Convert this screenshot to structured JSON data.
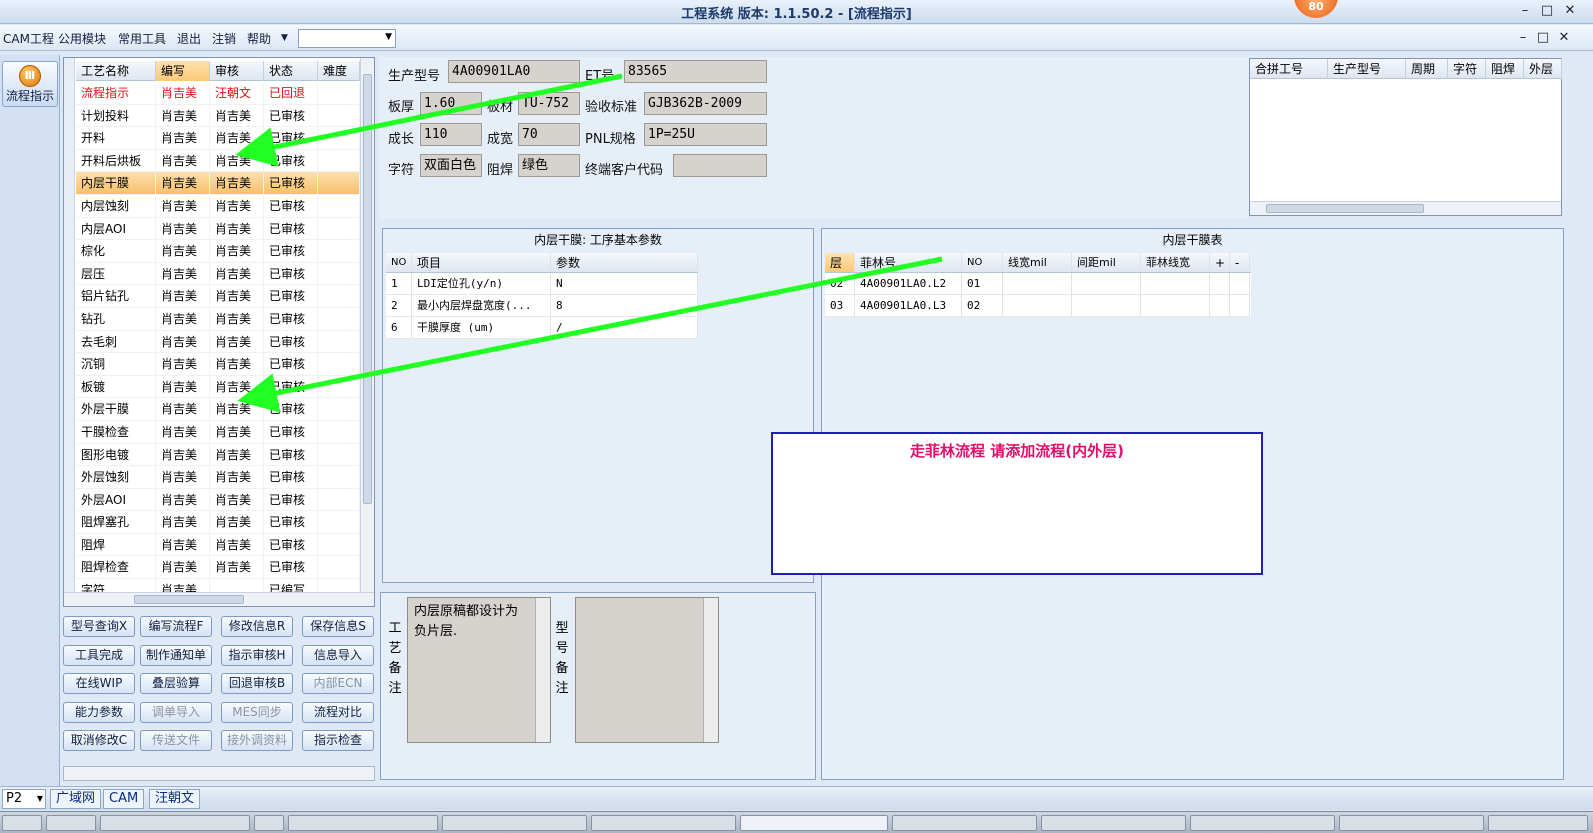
{
  "window": {
    "title": "工程系统  版本: 1.1.50.2 - [流程指示]",
    "badge": "80",
    "controls": [
      "–",
      "□",
      "✕"
    ],
    "inner_controls": [
      "–",
      "□",
      "✕"
    ]
  },
  "menu": {
    "items": [
      "CAM工程",
      "公用模块",
      "常用工具",
      "退出",
      "注销",
      "帮助"
    ],
    "combo_value": ""
  },
  "rail": {
    "button_label": "流程指示"
  },
  "process_list": {
    "columns": [
      "工艺名称",
      "编写",
      "审核",
      "状态",
      "难度"
    ],
    "rows": [
      [
        "流程指示",
        "肖吉美",
        "汪朝文",
        "已回退",
        ""
      ],
      [
        "计划投料",
        "肖吉美",
        "肖吉美",
        "已审核",
        ""
      ],
      [
        "开料",
        "肖吉美",
        "肖吉美",
        "已审核",
        ""
      ],
      [
        "开料后烘板",
        "肖吉美",
        "肖吉美",
        "已审核",
        ""
      ],
      [
        "内层干膜",
        "肖吉美",
        "肖吉美",
        "已审核",
        ""
      ],
      [
        "内层蚀刻",
        "肖吉美",
        "肖吉美",
        "已审核",
        ""
      ],
      [
        "内层AOI",
        "肖吉美",
        "肖吉美",
        "已审核",
        ""
      ],
      [
        "棕化",
        "肖吉美",
        "肖吉美",
        "已审核",
        ""
      ],
      [
        "层压",
        "肖吉美",
        "肖吉美",
        "已审核",
        ""
      ],
      [
        "铝片钻孔",
        "肖吉美",
        "肖吉美",
        "已审核",
        ""
      ],
      [
        "钻孔",
        "肖吉美",
        "肖吉美",
        "已审核",
        ""
      ],
      [
        "去毛刺",
        "肖吉美",
        "肖吉美",
        "已审核",
        ""
      ],
      [
        "沉铜",
        "肖吉美",
        "肖吉美",
        "已审核",
        ""
      ],
      [
        "板镀",
        "肖吉美",
        "肖吉美",
        "已审核",
        ""
      ],
      [
        "外层干膜",
        "肖吉美",
        "肖吉美",
        "已审核",
        ""
      ],
      [
        "干膜检查",
        "肖吉美",
        "肖吉美",
        "已审核",
        ""
      ],
      [
        "图形电镀",
        "肖吉美",
        "肖吉美",
        "已审核",
        ""
      ],
      [
        "外层蚀刻",
        "肖吉美",
        "肖吉美",
        "已审核",
        ""
      ],
      [
        "外层AOI",
        "肖吉美",
        "肖吉美",
        "已审核",
        ""
      ],
      [
        "阻焊塞孔",
        "肖吉美",
        "肖吉美",
        "已审核",
        ""
      ],
      [
        "阻焊",
        "肖吉美",
        "肖吉美",
        "已审核",
        ""
      ],
      [
        "阻焊检查",
        "肖吉美",
        "肖吉美",
        "已审核",
        ""
      ],
      [
        "字符",
        "肖吉美",
        "",
        "已编写",
        ""
      ]
    ],
    "selected_index": 4,
    "red_index": 0
  },
  "actions": [
    {
      "label": "型号查询X",
      "enabled": true
    },
    {
      "label": "编写流程F",
      "enabled": true
    },
    {
      "label": "修改信息R",
      "enabled": true
    },
    {
      "label": "保存信息S",
      "enabled": true
    },
    {
      "label": "工具完成",
      "enabled": true
    },
    {
      "label": "制作通知单",
      "enabled": true
    },
    {
      "label": "指示审核H",
      "enabled": true
    },
    {
      "label": "信息导入",
      "enabled": true
    },
    {
      "label": "在线WIP",
      "enabled": true
    },
    {
      "label": "叠层验算",
      "enabled": true
    },
    {
      "label": "回退审核B",
      "enabled": true
    },
    {
      "label": "内部ECN",
      "enabled": false
    },
    {
      "label": "能力参数",
      "enabled": true
    },
    {
      "label": "调单导入",
      "enabled": false
    },
    {
      "label": "MES同步",
      "enabled": false
    },
    {
      "label": "流程对比",
      "enabled": true
    },
    {
      "label": "取消修改C",
      "enabled": true
    },
    {
      "label": "传送文件",
      "enabled": false
    },
    {
      "label": "接外调资料",
      "enabled": false
    },
    {
      "label": "指示检查",
      "enabled": true
    }
  ],
  "header": {
    "model_label": "生产型号",
    "model_value": "4A00901LA0",
    "et_label": "ET号",
    "et_value": "83565",
    "thickness_label": "板厚",
    "thickness_value": "1.60",
    "material_label": "板材",
    "material_value": "TU-752",
    "standard_label": "验收标准",
    "standard_value": "GJB362B-2009",
    "length_label": "成长",
    "length_value": "110",
    "width_label": "成宽",
    "width_value": "70",
    "pnl_label": "PNL规格",
    "pnl_value": "1P=25U",
    "char_label": "字符",
    "char_value": "双面白色",
    "mask_label": "阻焊",
    "mask_value": "绿色",
    "customer_label": "终端客户代码",
    "customer_value": ""
  },
  "top_right_grid": {
    "columns": [
      "合拼工号",
      "生产型号",
      "周期",
      "字符",
      "阻焊",
      "外层"
    ]
  },
  "param_panel": {
    "title": "内层干膜: 工序基本参数",
    "columns": [
      "NO",
      "项目",
      "参数"
    ],
    "rows": [
      [
        "1",
        "LDI定位孔(y/n)",
        "N"
      ],
      [
        "2",
        "最小内层焊盘宽度(...",
        "8"
      ],
      [
        "6",
        "干膜厚度 (um)",
        "/"
      ]
    ]
  },
  "film_panel": {
    "title": "内层干膜表",
    "columns": [
      "层",
      "菲林号",
      "NO",
      "线宽mil",
      "间距mil",
      "菲林线宽",
      "+",
      "-"
    ],
    "rows": [
      [
        "02",
        "4A00901LA0.L2",
        "01",
        "",
        "",
        "",
        "",
        ""
      ],
      [
        "03",
        "4A00901LA0.L3",
        "02",
        "",
        "",
        "",
        "",
        ""
      ]
    ]
  },
  "note": {
    "text": "走菲林流程 请添加流程(内外层)"
  },
  "remarks": {
    "process_label": "工艺备注",
    "process_text": "内层原稿都设计为负片层.",
    "model_label": "型号备注",
    "model_text": ""
  },
  "status": {
    "combo_value": "P2",
    "tabs": [
      "广域网",
      "CAM",
      "汪朝文"
    ]
  },
  "colors": {
    "arrow": "#22ff22",
    "selected_row": "#f7c06a",
    "note_border": "#2020b0",
    "note_text": "#e0106a",
    "rejected": "#e01010"
  }
}
